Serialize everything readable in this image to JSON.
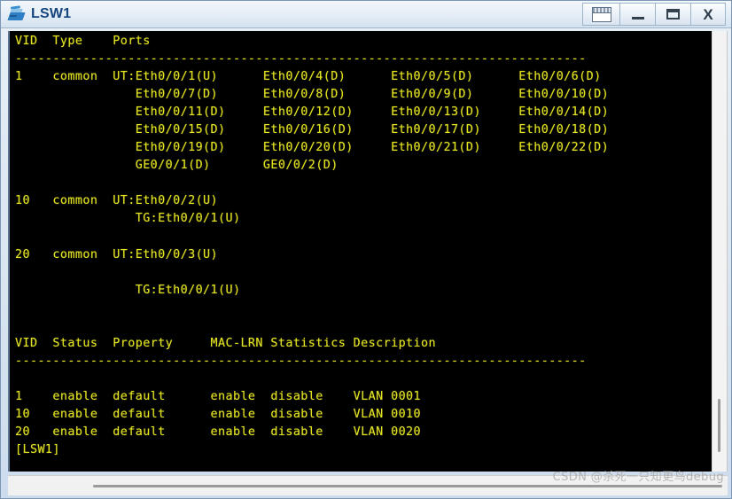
{
  "window": {
    "title": "LSW1",
    "icon": "switch-device-icon",
    "buttons": [
      {
        "name": "window-list-button",
        "label": ""
      },
      {
        "name": "minimize-button",
        "label": ""
      },
      {
        "name": "maximize-button",
        "label": ""
      },
      {
        "name": "close-button",
        "label": "X"
      }
    ]
  },
  "terminal": {
    "foreground_color": "#e3e322",
    "background_color": "#000000",
    "prompt": "[LSW1]",
    "text": "VID  Type    Ports\n----------------------------------------------------------------------------\n1    common  UT:Eth0/0/1(U)      Eth0/0/4(D)      Eth0/0/5(D)      Eth0/0/6(D)\n                Eth0/0/7(D)      Eth0/0/8(D)      Eth0/0/9(D)      Eth0/0/10(D)\n                Eth0/0/11(D)     Eth0/0/12(D)     Eth0/0/13(D)     Eth0/0/14(D)\n                Eth0/0/15(D)     Eth0/0/16(D)     Eth0/0/17(D)     Eth0/0/18(D)\n                Eth0/0/19(D)     Eth0/0/20(D)     Eth0/0/21(D)     Eth0/0/22(D)\n                GE0/0/1(D)       GE0/0/2(D)\n\n10   common  UT:Eth0/0/2(U)\n                TG:Eth0/0/1(U)\n\n20   common  UT:Eth0/0/3(U)\n\n                TG:Eth0/0/1(U)\n\n\nVID  Status  Property     MAC-LRN Statistics Description\n----------------------------------------------------------------------------\n\n1    enable  default      enable  disable    VLAN 0001\n10   enable  default      enable  disable    VLAN 0010\n20   enable  default      enable  disable    VLAN 0020\n[LSW1]"
  },
  "vlan_port_table": {
    "headers": [
      "VID",
      "Type",
      "Ports"
    ],
    "rows": [
      {
        "vid": "1",
        "type": "common",
        "ports": [
          [
            "UT:Eth0/0/1(U)",
            "Eth0/0/4(D)",
            "Eth0/0/5(D)",
            "Eth0/0/6(D)"
          ],
          [
            "Eth0/0/7(D)",
            "Eth0/0/8(D)",
            "Eth0/0/9(D)",
            "Eth0/0/10(D)"
          ],
          [
            "Eth0/0/11(D)",
            "Eth0/0/12(D)",
            "Eth0/0/13(D)",
            "Eth0/0/14(D)"
          ],
          [
            "Eth0/0/15(D)",
            "Eth0/0/16(D)",
            "Eth0/0/17(D)",
            "Eth0/0/18(D)"
          ],
          [
            "Eth0/0/19(D)",
            "Eth0/0/20(D)",
            "Eth0/0/21(D)",
            "Eth0/0/22(D)"
          ],
          [
            "GE0/0/1(D)",
            "GE0/0/2(D)"
          ]
        ]
      },
      {
        "vid": "10",
        "type": "common",
        "ports": [
          [
            "UT:Eth0/0/2(U)"
          ],
          [
            "TG:Eth0/0/1(U)"
          ]
        ]
      },
      {
        "vid": "20",
        "type": "common",
        "ports": [
          [
            "UT:Eth0/0/3(U)"
          ],
          [
            ""
          ],
          [
            "TG:Eth0/0/1(U)"
          ]
        ]
      }
    ]
  },
  "vlan_status_table": {
    "headers": [
      "VID",
      "Status",
      "Property",
      "MAC-LRN",
      "Statistics",
      "Description"
    ],
    "rows": [
      [
        "1",
        "enable",
        "default",
        "enable",
        "disable",
        "VLAN 0001"
      ],
      [
        "10",
        "enable",
        "default",
        "enable",
        "disable",
        "VLAN 0010"
      ],
      [
        "20",
        "enable",
        "default",
        "enable",
        "disable",
        "VLAN 0020"
      ]
    ]
  },
  "watermark": {
    "text": "CSDN @杀死一只知更鸟debug"
  }
}
